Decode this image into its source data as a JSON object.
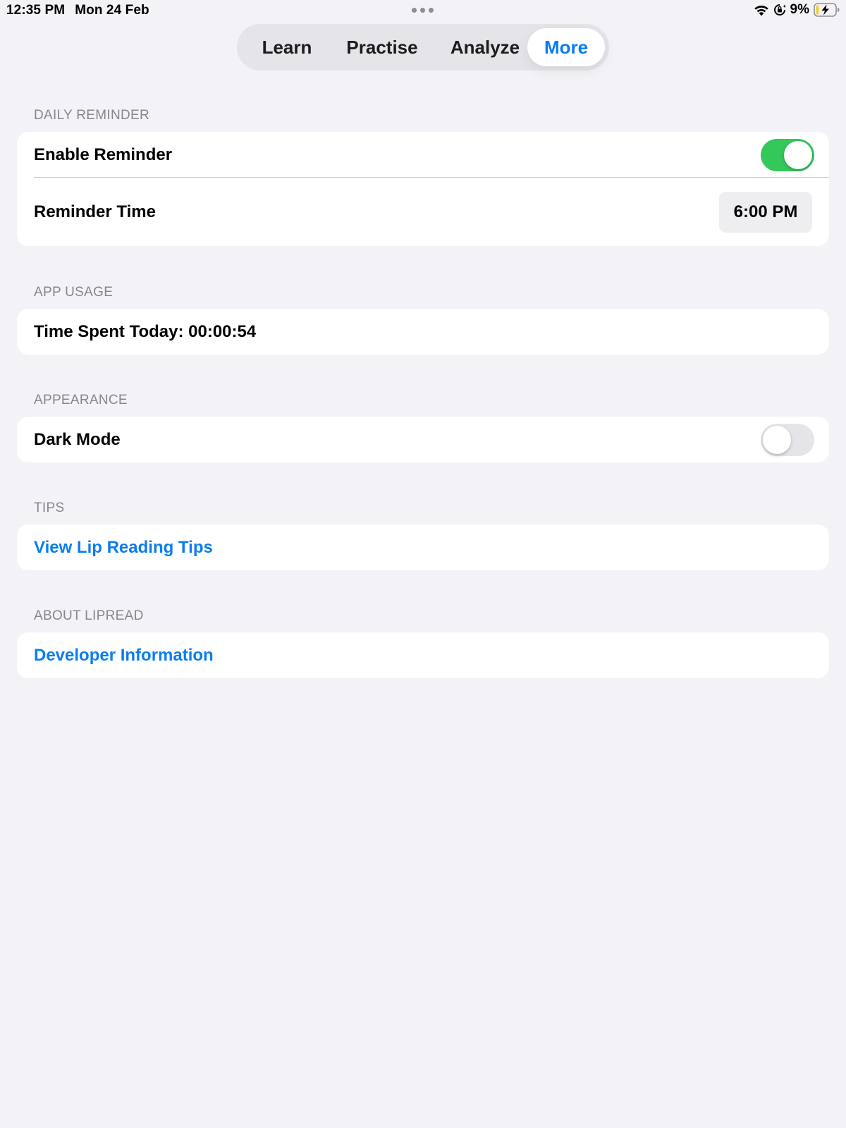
{
  "status_bar": {
    "time": "12:35 PM",
    "date": "Mon 24 Feb",
    "battery": "9%",
    "icons": [
      "wifi-icon",
      "orientation-lock-icon",
      "battery-charging-icon"
    ]
  },
  "tabs": [
    {
      "label": "Learn",
      "active": false
    },
    {
      "label": "Practise",
      "active": false
    },
    {
      "label": "Analyze",
      "active": false
    },
    {
      "label": "More",
      "active": true
    }
  ],
  "sections": {
    "daily_reminder": {
      "header": "DAILY REMINDER",
      "enable_label": "Enable Reminder",
      "enable_on": true,
      "time_label": "Reminder Time",
      "time_value": "6:00 PM"
    },
    "app_usage": {
      "header": "APP USAGE",
      "time_spent": "Time Spent Today: 00:00:54"
    },
    "appearance": {
      "header": "APPEARANCE",
      "dark_mode_label": "Dark Mode",
      "dark_mode_on": false
    },
    "tips": {
      "header": "TIPS",
      "link": "View Lip Reading Tips"
    },
    "about": {
      "header": "ABOUT LIPREAD",
      "link": "Developer Information"
    }
  },
  "colors": {
    "accent": "#0a7df0",
    "toggle_on": "#34c759",
    "background": "#f2f2f7",
    "battery_low": "#f5d033"
  }
}
